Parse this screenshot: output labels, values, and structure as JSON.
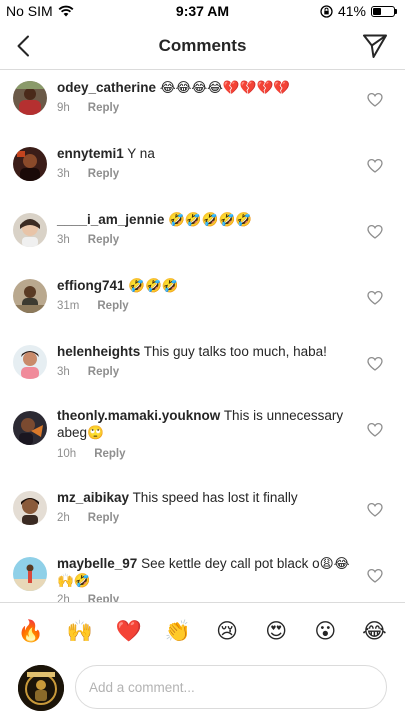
{
  "status_bar": {
    "carrier": "No SIM",
    "time": "9:37 AM",
    "battery": "41%",
    "battery_level": 0.41
  },
  "header": {
    "title": "Comments"
  },
  "comments": [
    {
      "username": "odey_catherine",
      "text": "😂😂😂😂💔💔💔💔",
      "time": "9h",
      "reply": "Reply"
    },
    {
      "username": "ennytemi1",
      "text": "Y na",
      "time": "3h",
      "reply": "Reply"
    },
    {
      "username": "____i_am_jennie",
      "text": "🤣🤣🤣🤣🤣",
      "time": "3h",
      "reply": "Reply"
    },
    {
      "username": "effiong741",
      "text": "🤣🤣🤣",
      "time": "31m",
      "reply": "Reply"
    },
    {
      "username": "helenheights",
      "text": "This guy talks too much, haba!",
      "time": "3h",
      "reply": "Reply"
    },
    {
      "username": "theonly.mamaki.youknow",
      "text": "This is unnecessary abeg🙄",
      "time": "10h",
      "reply": "Reply"
    },
    {
      "username": "mz_aibikay",
      "text": "This speed has lost it finally",
      "time": "2h",
      "reply": "Reply"
    },
    {
      "username": "maybelle_97",
      "text": "See kettle dey call pot black o😩😂🙌🤣",
      "time": "2h",
      "reply": "Reply"
    }
  ],
  "reactions": [
    "🔥",
    "🙌",
    "❤️",
    "👏",
    "😢",
    "😍",
    "😮",
    "😂"
  ],
  "composer": {
    "placeholder": "Add a comment..."
  },
  "icons": {
    "back": "chevron-left-icon",
    "send": "paper-plane-icon",
    "like": "heart-outline-icon",
    "wifi": "wifi-icon",
    "orientation_lock": "orientation-lock-icon",
    "battery": "battery-icon"
  }
}
